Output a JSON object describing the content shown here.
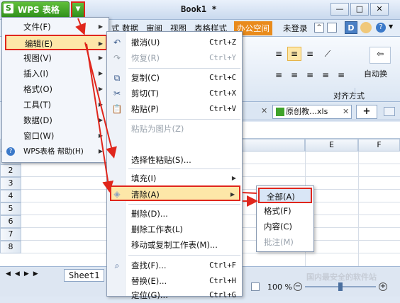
{
  "app": {
    "logo": "S",
    "title": "WPS 表格",
    "dropdown_glyph": "▼",
    "doc_title": "Book1 *",
    "win_min": "—",
    "win_max": "□",
    "win_close": "✕"
  },
  "tabs": [
    "式",
    "数据",
    "审阅",
    "视图",
    "表格样式",
    "办公空间"
  ],
  "login": "未登录",
  "ribbon": {
    "group_label": "对齐方式",
    "auto_wrap": "自动换"
  },
  "sheet_tabs": {
    "close": "✕",
    "doc2": "原创教…xls",
    "add": "+"
  },
  "col_headers": [
    "E",
    "F"
  ],
  "row_headers": [
    "2",
    "3",
    "4",
    "5",
    "6",
    "7",
    "8"
  ],
  "main_menu": [
    {
      "label": "文件(F)",
      "arrow": true
    },
    {
      "label": "编辑(E)",
      "arrow": true
    },
    {
      "label": "视图(V)",
      "arrow": true
    },
    {
      "label": "插入(I)",
      "arrow": true
    },
    {
      "label": "格式(O)",
      "arrow": true
    },
    {
      "label": "工具(T)",
      "arrow": true
    },
    {
      "label": "数据(D)",
      "arrow": true
    },
    {
      "label": "窗口(W)",
      "arrow": true
    },
    {
      "label": "WPS表格 帮助(H)",
      "arrow": true
    }
  ],
  "edit_menu": [
    {
      "label": "撤消(U)",
      "shortcut": "Ctrl+Z",
      "disabled": false
    },
    {
      "label": "恢复(R)",
      "shortcut": "Ctrl+Y",
      "disabled": true
    },
    {
      "label": "复制(C)",
      "shortcut": "Ctrl+C",
      "disabled": false
    },
    {
      "label": "剪切(T)",
      "shortcut": "Ctrl+X",
      "disabled": false
    },
    {
      "label": "粘贴(P)",
      "shortcut": "Ctrl+V",
      "disabled": false
    },
    {
      "label": "粘贴为图片(Z)",
      "shortcut": "",
      "disabled": true
    },
    {
      "label": "",
      "shortcut": "",
      "disabled": false
    },
    {
      "label": "选择性粘贴(S)...",
      "shortcut": "",
      "disabled": false
    },
    {
      "label": "填充(I)",
      "shortcut": "",
      "disabled": false
    },
    {
      "label": "清除(A)",
      "shortcut": "",
      "disabled": false
    },
    {
      "label": "删除(D)...",
      "shortcut": "",
      "disabled": false
    },
    {
      "label": "删除工作表(L)",
      "shortcut": "",
      "disabled": false
    },
    {
      "label": "移动或复制工作表(M)...",
      "shortcut": "",
      "disabled": false
    },
    {
      "label": "查找(F)...",
      "shortcut": "Ctrl+F",
      "disabled": false
    },
    {
      "label": "替换(E)...",
      "shortcut": "Ctrl+H",
      "disabled": false
    },
    {
      "label": "定位(G)...",
      "shortcut": "Ctrl+G",
      "disabled": false
    }
  ],
  "clear_menu": [
    {
      "label": "全部(A)",
      "disabled": false
    },
    {
      "label": "格式(F)",
      "disabled": false
    },
    {
      "label": "内容(C)",
      "disabled": false
    },
    {
      "label": "批注(M)",
      "disabled": true
    }
  ],
  "sheet_name": "Sheet1",
  "zoom": "100 %",
  "watermark": "国内最安全的软件站",
  "colors": {
    "highlight": "#e0261c",
    "wps_green": "#3fa32a",
    "accent_tab": "#e98b1c"
  }
}
